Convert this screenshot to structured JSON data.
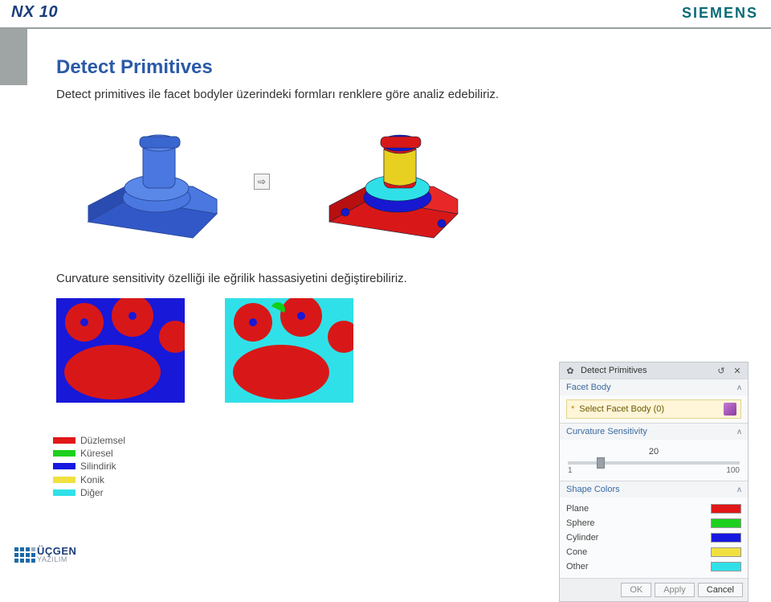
{
  "header": {
    "product": "NX 10",
    "brand": "SIEMENS"
  },
  "page": {
    "title": "Detect Primitives",
    "intro": "Detect primitives ile facet bodyler üzerindeki formları  renklere göre analiz edebiliriz.",
    "desc2": "Curvature sensitivity özelliği ile eğrilik hassasiyetini değiştirebiliriz."
  },
  "legend": {
    "items": [
      {
        "label": "Düzlemsel",
        "color": "#e01818"
      },
      {
        "label": "Küresel",
        "color": "#1ed01e"
      },
      {
        "label": "Silindirik",
        "color": "#1818e0"
      },
      {
        "label": "Konik",
        "color": "#f0e040"
      },
      {
        "label": "Diğer",
        "color": "#30e0e8"
      }
    ]
  },
  "dialog": {
    "title": "Detect Primitives",
    "facet_section": "Facet Body",
    "select_label": "Select Facet Body (0)",
    "curvature_section": "Curvature Sensitivity",
    "slider": {
      "value": "20",
      "min": "1",
      "max": "100",
      "pos_pct": 19
    },
    "colors_section": "Shape Colors",
    "shape_colors": [
      {
        "label": "Plane",
        "color": "#e01818"
      },
      {
        "label": "Sphere",
        "color": "#1ed01e"
      },
      {
        "label": "Cylinder",
        "color": "#1818e0"
      },
      {
        "label": "Cone",
        "color": "#f0e040"
      },
      {
        "label": "Other",
        "color": "#30e0e8"
      }
    ],
    "buttons": {
      "ok": "OK",
      "apply": "Apply",
      "cancel": "Cancel"
    }
  },
  "footer": {
    "brand1": "ÜÇGEN",
    "brand2": "YAZILIM"
  },
  "arrow_glyph": "⇨"
}
